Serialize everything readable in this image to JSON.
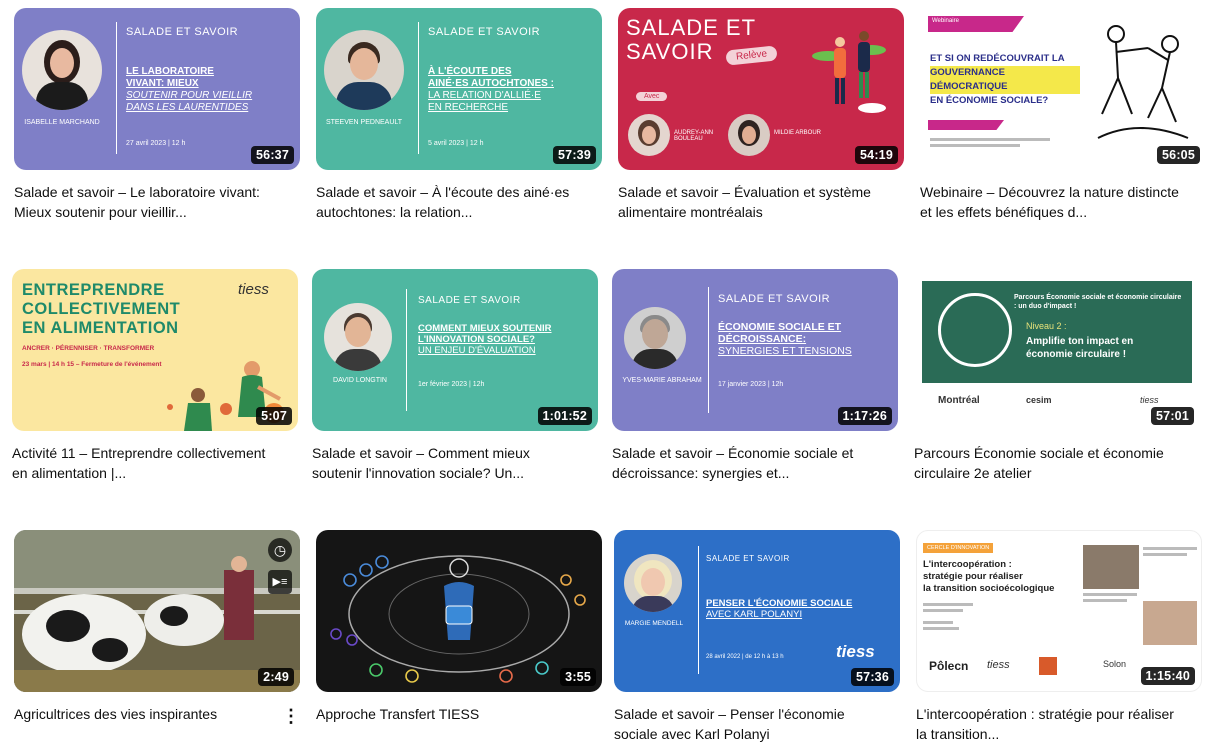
{
  "videos": [
    {
      "title": "Salade et savoir – Le laboratoire vivant: Mieux soutenir pour vieillir...",
      "duration": "56:37",
      "thumb": {
        "bg": "#7f7fc7",
        "series": "SALADE ET SAVOIR",
        "line1": "LE LABORATOIRE",
        "line2": "VIVANT: MIEUX",
        "line3": "SOUTENIR POUR VIEILLIR",
        "line4": "DANS LES LAURENTIDES",
        "guest": "ISABELLE MARCHAND",
        "date": "27 avril 2023 | 12 h"
      }
    },
    {
      "title": "Salade et savoir – À l'écoute des ainé·es autochtones: la relation...",
      "duration": "57:39",
      "thumb": {
        "bg": "#4fb7a1",
        "series": "SALADE ET SAVOIR",
        "line1": "À L'ÉCOUTE DES",
        "line2": "AINÉ·ES AUTOCHTONES :",
        "line3": "LA RELATION D'ALLIÉ·E",
        "line4": "EN RECHERCHE",
        "guest": "STEEVEN PEDNEAULT",
        "date": "5 avril 2023 | 12 h"
      }
    },
    {
      "title": "Salade et savoir – Évaluation et système alimentaire montréalais",
      "duration": "54:19",
      "thumb": {
        "bg": "#c8284a",
        "line1": "SALADE ET",
        "line2": "SAVOIR",
        "tag": "Relève",
        "avec": "Avec",
        "guest1": "AUDREY-ANN BOULEAU",
        "guest2": "MILDIE ARBOUR"
      }
    },
    {
      "title": "Webinaire – Découvrez la nature distincte et les effets bénéfiques d...",
      "duration": "56:05",
      "thumb": {
        "bg": "#ffffff",
        "flag": "Webinaire",
        "line1": "ET SI ON REDÉCOUVRAIT LA",
        "line2": "GOUVERNANCE DÉMOCRATIQUE",
        "line3": "EN ÉCONOMIE SOCIALE?"
      }
    },
    {
      "title": "Activité 11 – Entreprendre collectivement en alimentation |...",
      "duration": "5:07",
      "thumb": {
        "bg": "#fbe7a0",
        "line1": "ENTREPRENDRE",
        "line2": "COLLECTIVEMENT",
        "line3": "EN ALIMENTATION",
        "sub": "ANCRER · PÉRENNISER · TRANSFORMER",
        "date": "23 mars | 14 h 15 – Fermeture de l'événement",
        "logo": "tiess"
      }
    },
    {
      "title": "Salade et savoir – Comment mieux soutenir l'innovation sociale? Un...",
      "duration": "1:01:52",
      "thumb": {
        "bg": "#4fb7a1",
        "series": "SALADE ET SAVOIR",
        "line1": "COMMENT MIEUX SOUTENIR",
        "line2": "L'INNOVATION SOCIALE?",
        "line3": "UN ENJEU D'ÉVALUATION",
        "guest": "DAVID LONGTIN",
        "date": "1er février 2023 | 12h"
      }
    },
    {
      "title": "Salade et savoir – Économie sociale et décroissance: synergies et...",
      "duration": "1:17:26",
      "thumb": {
        "bg": "#7f7fc7",
        "series": "SALADE ET SAVOIR",
        "line1": "ÉCONOMIE SOCIALE ET",
        "line2": "DÉCROISSANCE:",
        "line3": "SYNERGIES ET TENSIONS",
        "guest": "YVES-MARIE ABRAHAM",
        "date": "17 janvier 2023 | 12h"
      }
    },
    {
      "title": "Parcours Économie sociale et économie circulaire 2e atelier",
      "duration": "57:01",
      "thumb": {
        "bg": "#ffffff",
        "band": "#2a6b56",
        "top": "Parcours Économie sociale et économie circulaire : un duo d'impact !",
        "niveau": "Niveau 2 :",
        "main": "Amplifie ton impact en économie circulaire !",
        "logo1": "Montréal",
        "logo2": "cesim",
        "logo3": "tiess"
      }
    },
    {
      "title": "Agricultrices des vies inspirantes",
      "duration": "2:49",
      "thumb": {
        "bg": "#5b6a58"
      }
    },
    {
      "title": "Approche Transfert TIESS",
      "duration": "3:55",
      "thumb": {
        "bg": "#151515"
      }
    },
    {
      "title": "Salade et savoir – Penser l'économie sociale avec Karl Polanyi",
      "duration": "57:36",
      "thumb": {
        "bg": "#2d6fc7",
        "series": "SALADE ET SAVOIR",
        "line1": "PENSER L'ÉCONOMIE SOCIALE",
        "line2": "AVEC KARL POLANYI",
        "guest": "MARGIE MENDELL",
        "date": "28 avril 2022 | de 12 h à 13 h",
        "logo": "tiess"
      }
    },
    {
      "title": "L'intercoopération : stratégie pour réaliser la transition...",
      "duration": "1:15:40",
      "thumb": {
        "bg": "#ffffff",
        "badge": "CERCLE D'INNOVATION",
        "line1": "L'intercoopération :",
        "line2": "stratégie pour réaliser",
        "line3": "la transition socioécologique",
        "logo1": "Pôlecn",
        "logo2": "tiess",
        "logo3": "Solon"
      }
    }
  ],
  "menu_icon": "more-vert-icon",
  "colors": {
    "duration_bg": "#000000",
    "text": "#0f0f0f"
  }
}
